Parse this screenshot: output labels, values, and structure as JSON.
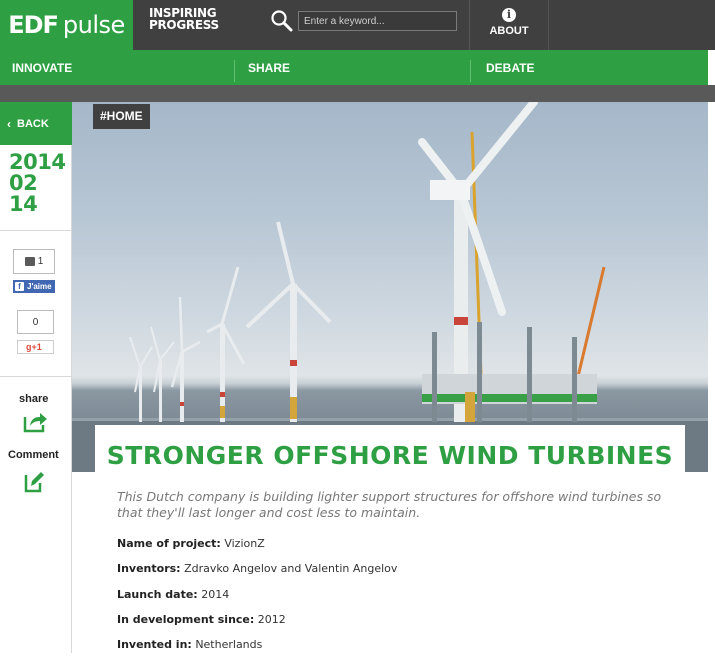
{
  "header": {
    "logo_edf": "EDF",
    "logo_pulse": "pulse",
    "tagline_line1": "INSPIRING",
    "tagline_line2": "PROGRESS",
    "search_placeholder": "Enter a keyword...",
    "about_label": "ABOUT"
  },
  "nav": {
    "items": [
      {
        "label": "INNOVATE"
      },
      {
        "label": "SHARE"
      },
      {
        "label": "DEBATE"
      }
    ]
  },
  "sidebar": {
    "back_label": "BACK",
    "date": {
      "year": "2014",
      "month": "02",
      "day": "14"
    },
    "like_count": "1",
    "fb_label": "J'aime",
    "gplus_count": "0",
    "gplus_label": "+1",
    "share_label": "share",
    "comment_label": "Comment"
  },
  "hero": {
    "tag": "#HOME"
  },
  "article": {
    "title": "STRONGER OFFSHORE WIND TURBINES",
    "lead": "This Dutch company is building lighter support structures for offshore wind turbines so that they'll last longer and cost less to maintain.",
    "facts": [
      {
        "key": "Name of project:",
        "value": "VizionZ"
      },
      {
        "key": "Inventors:",
        "value": "Zdravko Angelov and Valentin Angelov"
      },
      {
        "key": "Launch date:",
        "value": "2014"
      },
      {
        "key": "In development since:",
        "value": "2012"
      },
      {
        "key": "Invented in:",
        "value": "Netherlands"
      }
    ]
  },
  "colors": {
    "brand_green": "#2ea043",
    "header_dark": "#404040"
  }
}
